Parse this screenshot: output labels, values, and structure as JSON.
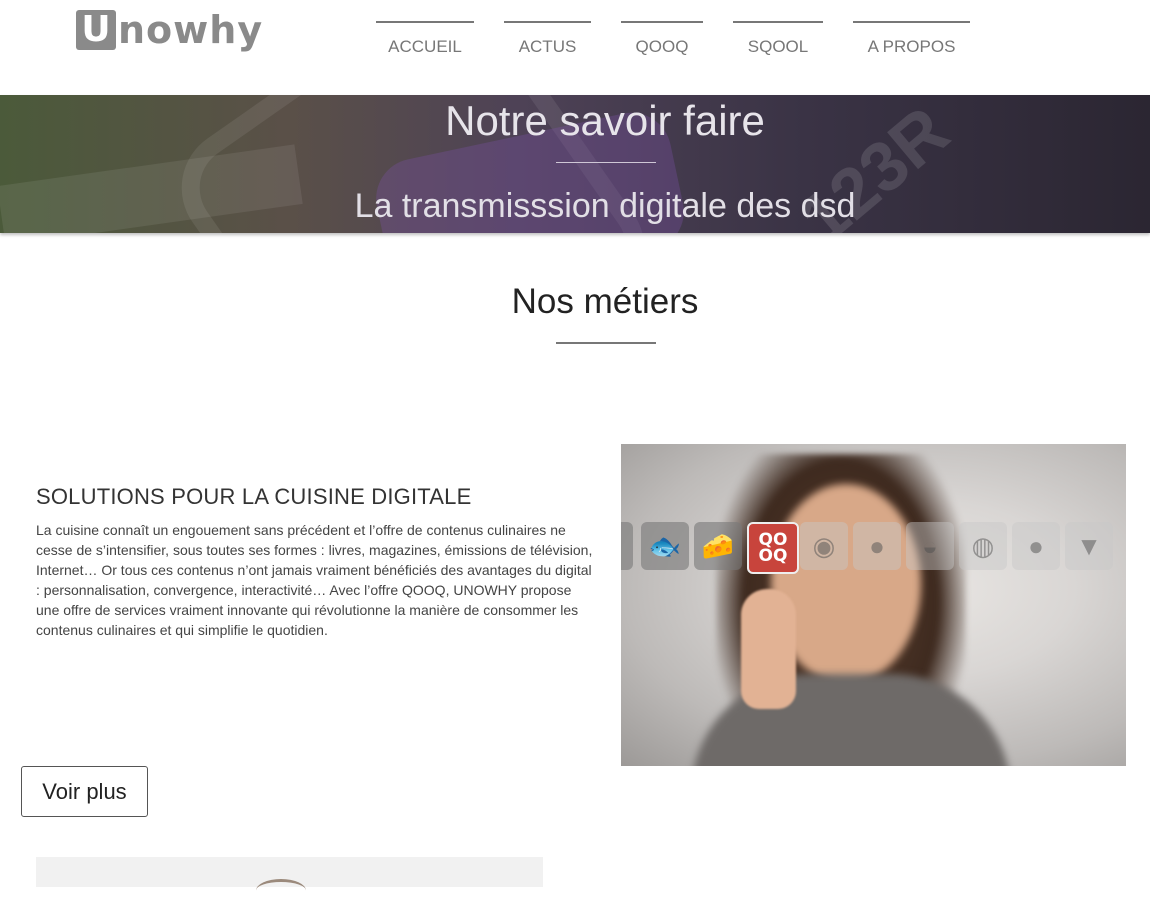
{
  "header": {
    "logo_letter": "U",
    "logo_rest": "nowhy",
    "nav": [
      {
        "label": "ACCUEIL"
      },
      {
        "label": "ACTUS"
      },
      {
        "label": "QOOQ"
      },
      {
        "label": "SQOOL"
      },
      {
        "label": "A PROPOS"
      }
    ]
  },
  "hero": {
    "title": "Notre savoir faire",
    "subtitle": "La transmisssion digitale des dsd"
  },
  "section": {
    "title": "Nos métiers"
  },
  "card": {
    "title": "SOLUTIONS POUR LA CUISINE DIGITALE",
    "text": "La cuisine connaît un engouement sans précédent et l’offre de contenus culinaires ne cesse de s’intensifier, sous toutes ses formes : livres, magazines, émissions de télévision, Internet… Or tous ces contenus n’ont jamais vraiment bénéficiés des avantages du digital : personnalisation, convergence, interactivité… Avec l’offre QOOQ, UNOWHY propose une offre de services vraiment innovante qui révolutionne la manière de consommer les contenus culinaires et qui simplifie le quotidien.",
    "button_label": "Voir plus",
    "photo": {
      "icons": [
        "fish-icon",
        "cheese-icon",
        "qooq-logo-icon",
        "spices-icon",
        "tomato-icon",
        "bread-icon",
        "pizza-icon",
        "apple-icon",
        "ice-cream-icon"
      ],
      "qooq_logo_text": "QO\nOQ"
    }
  },
  "colors": {
    "nav_text": "#777777",
    "accent_red": "#c8443c",
    "hero_text": "#e7e4ea"
  }
}
